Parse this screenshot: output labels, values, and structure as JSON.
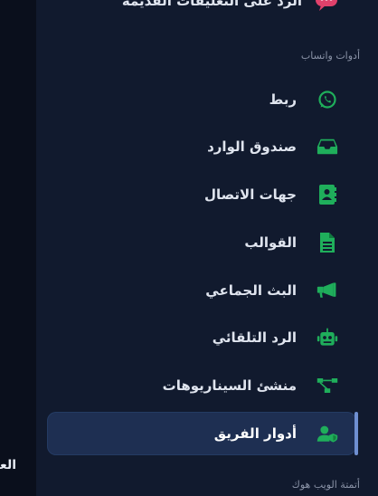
{
  "left_pane": {
    "cut_text": "العـ"
  },
  "sidebar": {
    "top_item": {
      "label": "الرد على التعليقات القديمة",
      "icon": "chat-bubble-icon",
      "color": "#e0416b"
    },
    "sections": [
      {
        "title": "أدوات واتساب",
        "items": [
          {
            "label": "ربط",
            "icon": "whatsapp-icon"
          },
          {
            "label": "صندوق الوارد",
            "icon": "inbox-icon"
          },
          {
            "label": "جهات الاتصال",
            "icon": "contact-book-icon"
          },
          {
            "label": "القوالب",
            "icon": "document-icon"
          },
          {
            "label": "البث الجماعي",
            "icon": "megaphone-icon"
          },
          {
            "label": "الرد التلقائي",
            "icon": "robot-icon"
          },
          {
            "label": "منشئ السيناريوهات",
            "icon": "flow-diagram-icon"
          },
          {
            "label": "أدوار الفريق",
            "icon": "user-shield-icon",
            "active": true
          }
        ]
      },
      {
        "title": "أتمتة الويب هوك"
      }
    ],
    "icon_color": "#1fae5b",
    "active_color": "#1e2f52"
  }
}
